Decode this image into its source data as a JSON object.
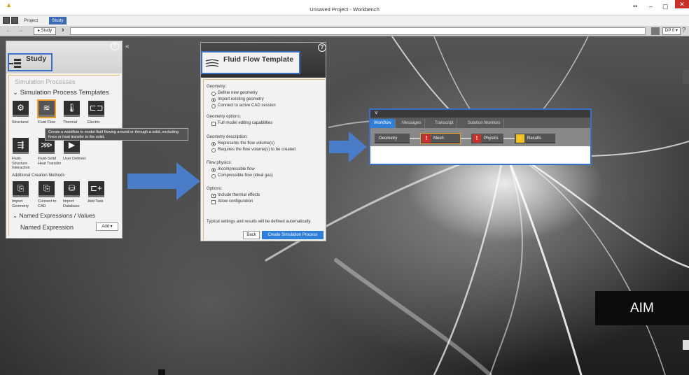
{
  "window": {
    "title": "Unsaved Project - Workbench",
    "min": "–",
    "max": "▢",
    "close": "✕",
    "extra": "••"
  },
  "tabs": [
    {
      "label": "Project"
    },
    {
      "label": "Study"
    }
  ],
  "navbar": {
    "breadcrumb": "▸ Study",
    "dp_button": "DP 0 ▾",
    "help": "?"
  },
  "study_panel": {
    "title": "Study",
    "help": "?",
    "collapse": "«",
    "sections": {
      "processes": "Simulation Processes",
      "templates": "Simulation Process Templates",
      "additional": "Additional Creation Methods",
      "named_expr": "Named Expressions / Values"
    },
    "templates": [
      {
        "label": "Structural",
        "icon": "structural-icon"
      },
      {
        "label": "Fluid Flow",
        "icon": "fluid-flow-icon"
      },
      {
        "label": "Thermal",
        "icon": "thermal-icon"
      },
      {
        "label": "Electric",
        "icon": "electric-icon"
      },
      {
        "label": "Fluid-Structure Interaction",
        "icon": "fsi-icon"
      },
      {
        "label": "Fluid-Solid Heat Transfer",
        "icon": "fluid-solid-heat-icon"
      },
      {
        "label": "User Defined",
        "icon": "user-defined-icon"
      }
    ],
    "methods": [
      {
        "label": "Import Geometry",
        "icon": "import-geometry-icon"
      },
      {
        "label": "Connect to CAD",
        "icon": "connect-cad-icon"
      },
      {
        "label": "Import Database",
        "icon": "import-database-icon"
      },
      {
        "label": "Add Task",
        "icon": "add-task-icon"
      }
    ],
    "tooltip": "Create a workflow to model fluid flowing around or through a solid, excluding force or heat transfer to the solid.",
    "named_expression_label": "Named Expression",
    "add_button": "Add ▾"
  },
  "fluid_flow": {
    "title": "Fluid Flow Template",
    "help": "?",
    "geometry_label": "Geometry:",
    "geometry_options": [
      "Define new geometry",
      "Import existing geometry",
      "Connect to active CAD session"
    ],
    "geometry_selected": 1,
    "geometry_options_label": "Geometry options:",
    "full_model_editing": "Full model editing capabilities",
    "geometry_desc_label": "Geometry description:",
    "geometry_desc_options": [
      "Represents the flow volume(s)",
      "Requires the flow volume(s) to be created"
    ],
    "flow_physics_label": "Flow physics:",
    "flow_physics_options": [
      "Incompressible flow",
      "Compressible flow (ideal gas)"
    ],
    "options_label": "Options:",
    "include_thermal": "Include thermal effects",
    "allow_config": "Allow configuration",
    "footer_text": "Typical settings and results will be defined automatically.",
    "back_button": "Back",
    "create_button": "Create Simulation Process"
  },
  "workflow_panel": {
    "collapse": "˅",
    "tabs": [
      "Workflow",
      "Messages",
      "Transcript",
      "Solution Monitors"
    ],
    "active_tab": 0,
    "nodes": [
      {
        "label": "Geometry",
        "status": "none"
      },
      {
        "label": "Mesh",
        "status": "warning"
      },
      {
        "label": "Physics",
        "status": "warning"
      },
      {
        "label": "Results",
        "status": "lightning"
      }
    ]
  },
  "aim_label": "AIM",
  "colors": {
    "highlight_blue": "#3a6fc4",
    "arrow_blue": "#4a7cc8",
    "accent_orange": "#f0a030",
    "button_blue": "#2f7ed8",
    "warning_red": "#c8302a"
  }
}
